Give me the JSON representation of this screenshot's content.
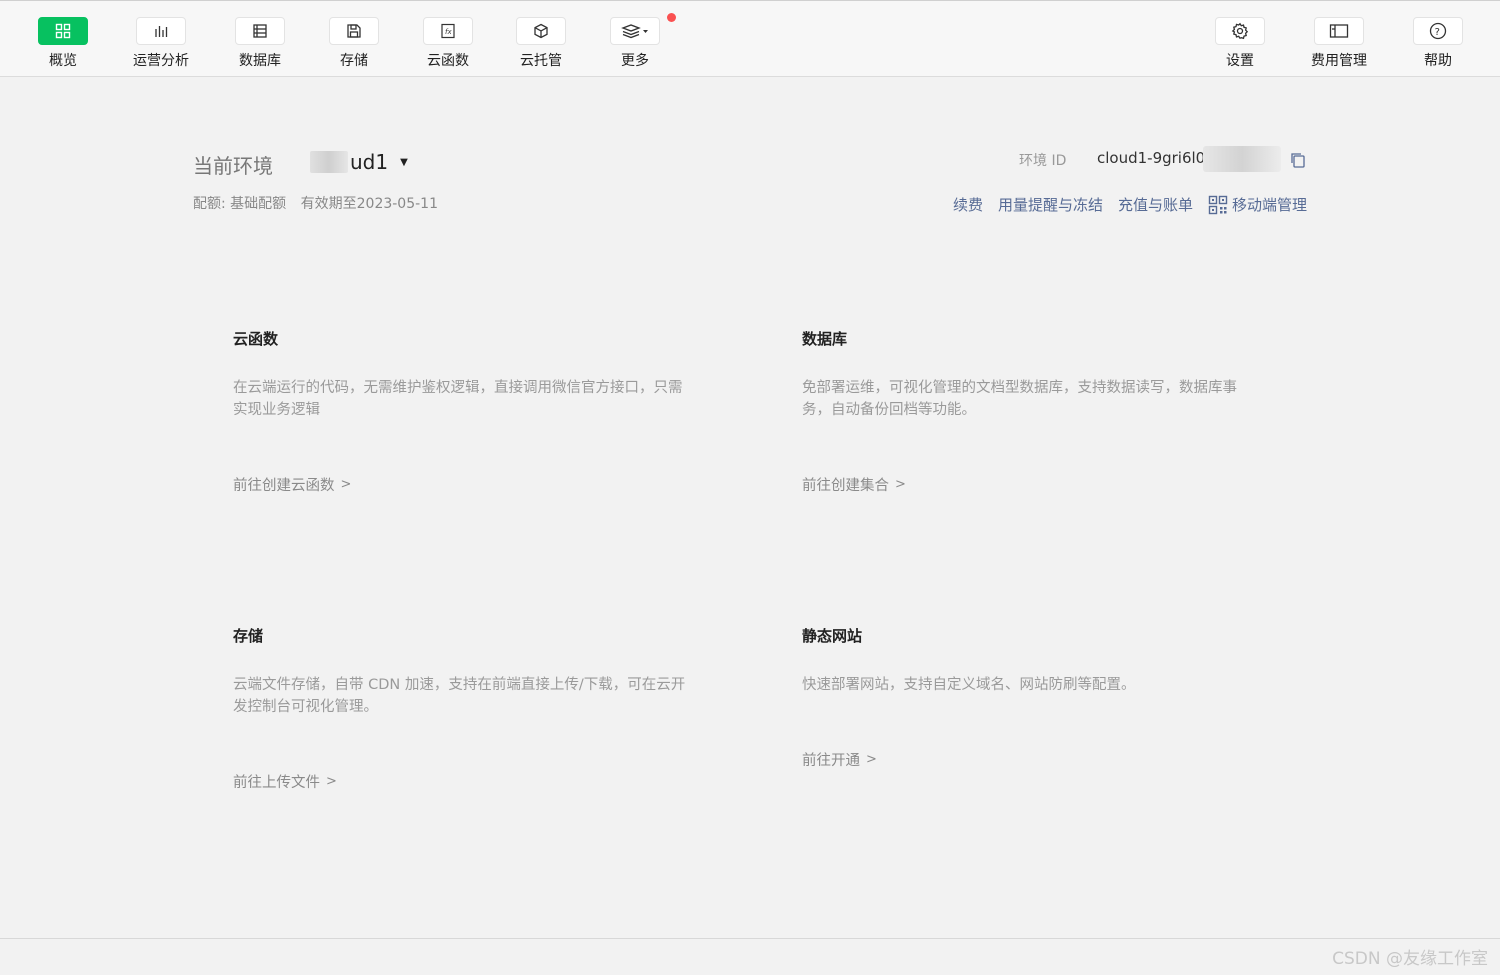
{
  "toolbar": {
    "left_items": [
      {
        "label": "概览",
        "icon": "grid-icon",
        "active": true
      },
      {
        "label": "运营分析",
        "icon": "bar-chart-icon"
      },
      {
        "label": "数据库",
        "icon": "database-icon"
      },
      {
        "label": "存储",
        "icon": "save-icon"
      },
      {
        "label": "云函数",
        "icon": "function-icon"
      },
      {
        "label": "云托管",
        "icon": "cube-icon"
      },
      {
        "label": "更多",
        "icon": "layers-icon",
        "badge": true
      }
    ],
    "right_items": [
      {
        "label": "设置",
        "icon": "gear-icon"
      },
      {
        "label": "费用管理",
        "icon": "wallet-icon"
      },
      {
        "label": "帮助",
        "icon": "help-icon"
      }
    ]
  },
  "env": {
    "label": "当前环境",
    "name_visible": "ud1",
    "quota": "配额: 基础配额",
    "expiry": "有效期至2023-05-11",
    "id_label": "环境 ID",
    "id_value": "cloud1-9gri6l0c"
  },
  "links": [
    "续费",
    "用量提醒与冻结",
    "充值与账单",
    "移动端管理"
  ],
  "cards": [
    {
      "title": "云函数",
      "desc": "在云端运行的代码，无需维护鉴权逻辑，直接调用微信官方接口，只需实现业务逻辑",
      "link": "前往创建云函数"
    },
    {
      "title": "数据库",
      "desc": "免部署运维，可视化管理的文档型数据库，支持数据读写，数据库事务，自动备份回档等功能。",
      "link": "前往创建集合"
    },
    {
      "title": "存储",
      "desc": "云端文件存储，自带 CDN 加速，支持在前端直接上传/下载，可在云开发控制台可视化管理。",
      "link": "前往上传文件"
    },
    {
      "title": "静态网站",
      "desc": "快速部署网站，支持自定义域名、网站防刷等配置。",
      "link": "前往开通"
    }
  ],
  "watermark": "CSDN @友缘工作室",
  "colors": {
    "accent": "#07c160",
    "link": "#576b95",
    "badge": "#fa5151"
  }
}
